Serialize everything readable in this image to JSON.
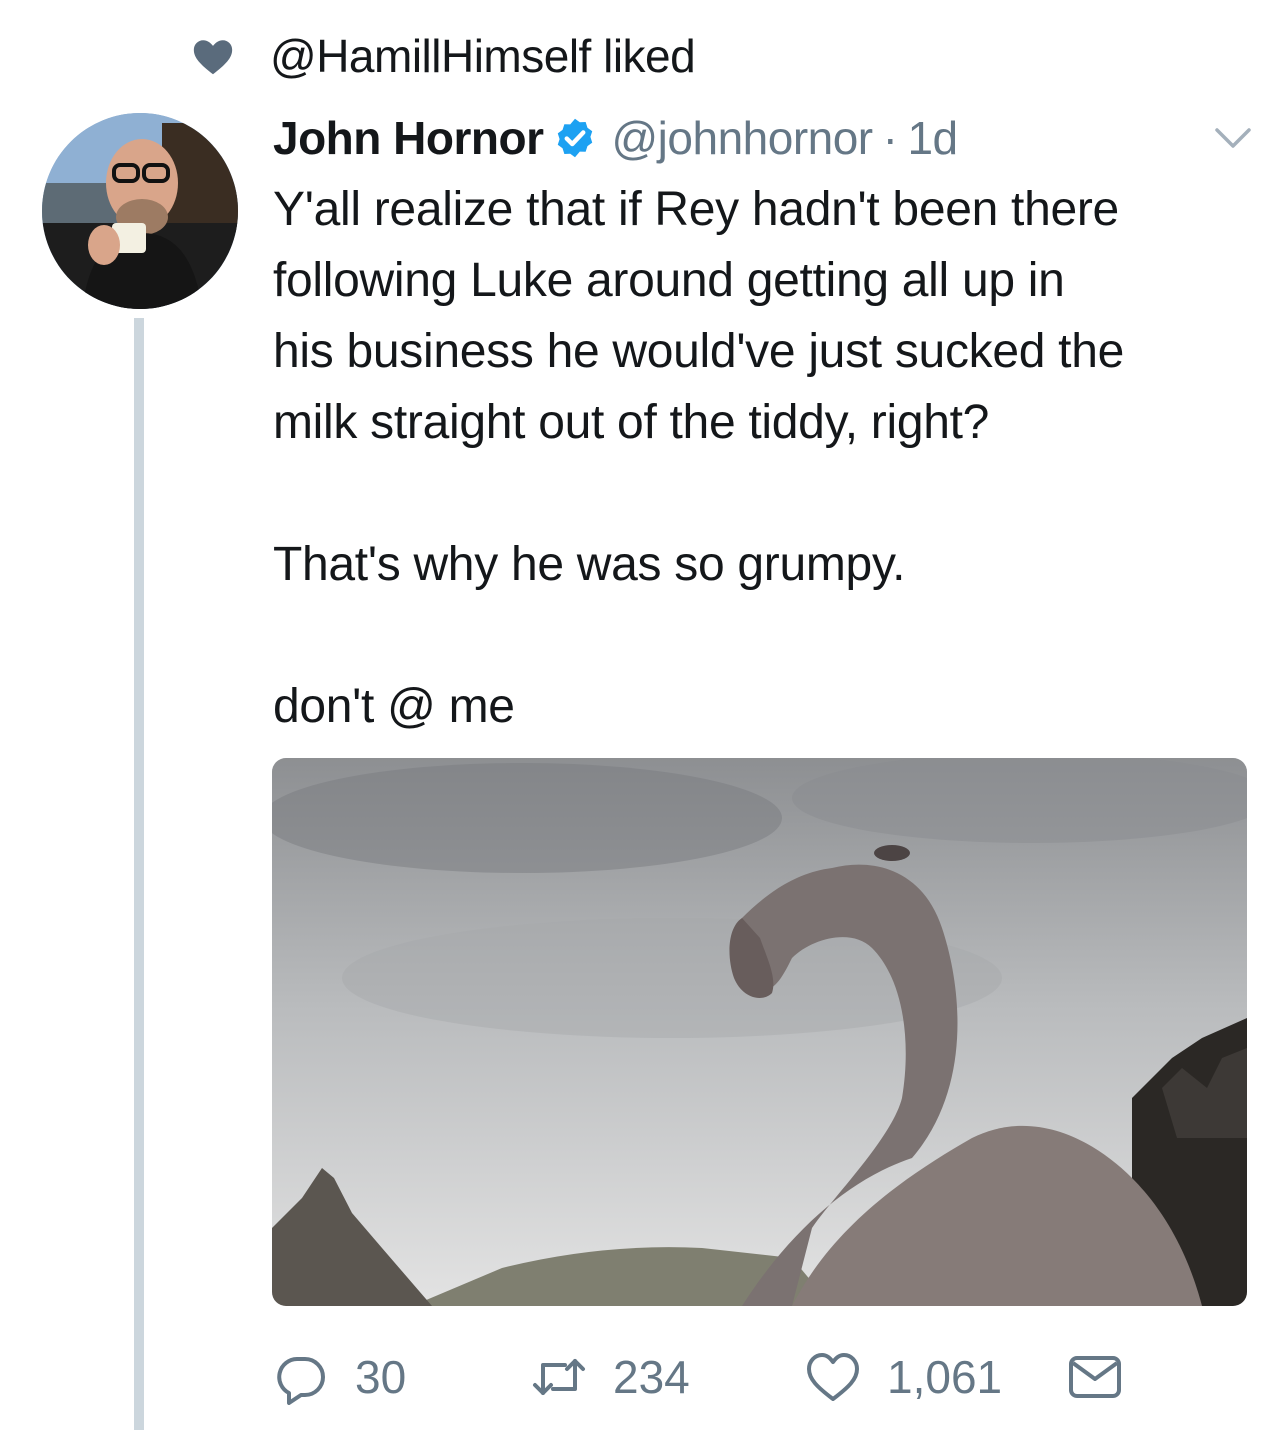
{
  "social_context": {
    "text": "@HamillHimself liked"
  },
  "tweet": {
    "author_name": "John Hornor",
    "author_handle": "@johnhornor",
    "separator": "·",
    "time": "1d",
    "text_lines": [
      "Y'all realize that if Rey hadn't been there",
      "following Luke around getting all up in",
      "his business he would've just sucked the",
      "milk straight out of the tiddy, right?"
    ],
    "text_paragraph_2": "That's why he was so grumpy.",
    "text_paragraph_3": "don't @ me",
    "reply_count": "30",
    "retweet_count": "234",
    "like_count": "1,061"
  },
  "icons": {
    "context": "heart-icon",
    "verified": "verified-badge-icon",
    "menu": "chevron-down-icon",
    "reply": "reply-icon",
    "retweet": "retweet-icon",
    "like": "heart-outline-icon",
    "dm": "mail-icon"
  },
  "colors": {
    "text": "#14171a",
    "secondary": "#657786",
    "verified": "#1da1f2",
    "thread_line": "#ccd6dd",
    "context_heart": "#657786"
  }
}
